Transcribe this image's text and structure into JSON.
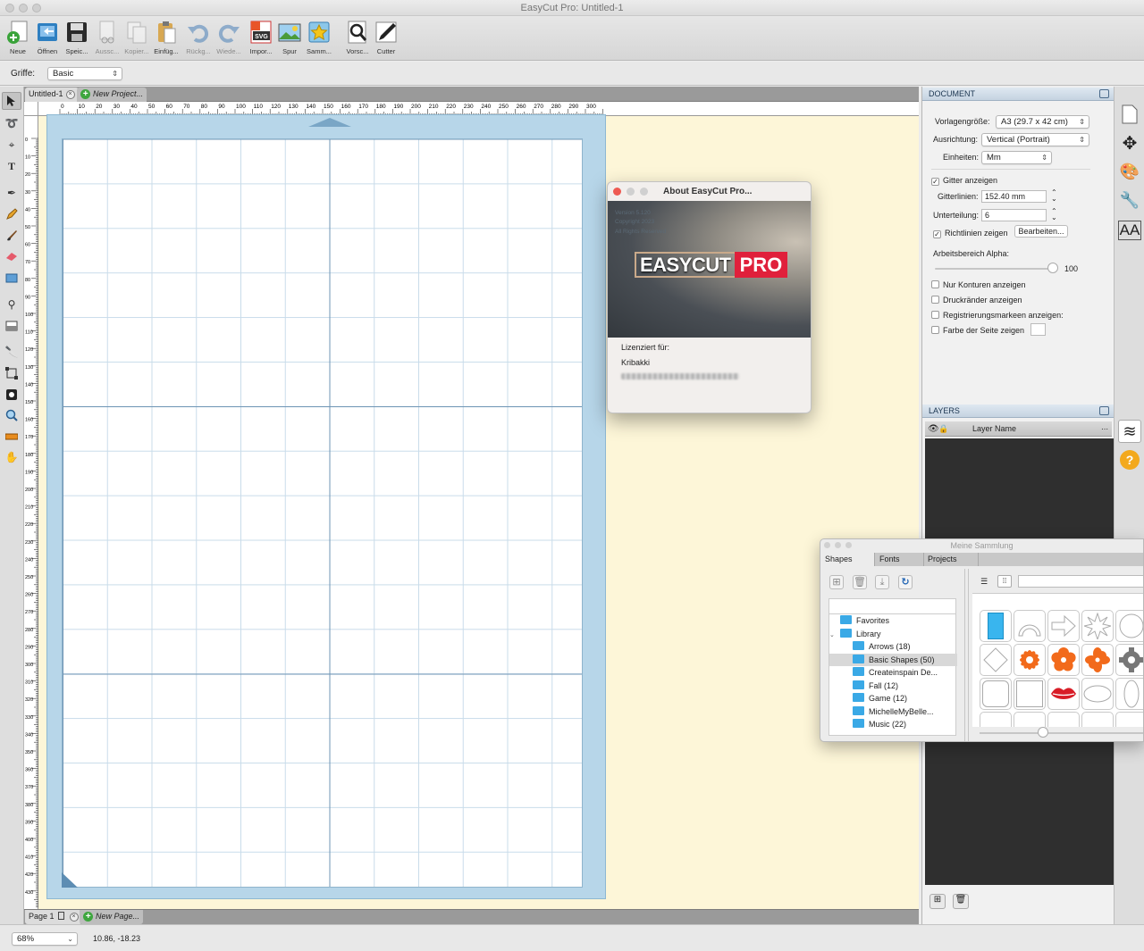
{
  "window": {
    "title": "EasyCut Pro: Untitled-1"
  },
  "toolbar": {
    "items": [
      {
        "label": "Neue",
        "icon": "new-document-icon",
        "enabled": true
      },
      {
        "label": "Öffnen",
        "icon": "open-folder-icon",
        "enabled": true
      },
      {
        "label": "Speic...",
        "icon": "save-icon",
        "enabled": true
      },
      {
        "label": "Aussc...",
        "icon": "cut-icon",
        "enabled": false
      },
      {
        "label": "Kopier...",
        "icon": "copy-icon",
        "enabled": false
      },
      {
        "label": "Einfüg...",
        "icon": "paste-icon",
        "enabled": false
      },
      {
        "label": "Rückg...",
        "icon": "undo-icon",
        "enabled": false
      },
      {
        "label": "Wiede...",
        "icon": "redo-icon",
        "enabled": false
      },
      {
        "label": "Impor...",
        "icon": "import-svg-icon",
        "enabled": true
      },
      {
        "label": "Spur",
        "icon": "trace-icon",
        "enabled": true
      },
      {
        "label": "Samm...",
        "icon": "collection-icon",
        "enabled": true
      },
      {
        "label": "Vorsc...",
        "icon": "preview-icon",
        "enabled": true
      },
      {
        "label": "Cutter",
        "icon": "cutter-icon",
        "enabled": true
      }
    ]
  },
  "options": {
    "griffe_label": "Griffe:",
    "griffe_value": "Basic"
  },
  "tools": [
    "select-arrow-icon",
    "lasso-icon",
    "node-edit-icon",
    "text-tool-icon",
    "pen-tool-icon",
    "pencil-icon",
    "brush-icon",
    "eraser-icon",
    "rectangle-icon",
    "eyedropper-icon",
    "fill-icon",
    "knife-icon",
    "transform-icon",
    "weld-icon",
    "zoom-icon",
    "measure-icon",
    "hand-icon"
  ],
  "doc_tabs": {
    "active": "Untitled-1",
    "new_project": "New Project..."
  },
  "ruler": {
    "top_labels": [
      "0",
      "10",
      "20",
      "30",
      "40",
      "50",
      "60",
      "70",
      "80",
      "90",
      "100",
      "110",
      "120",
      "130",
      "140",
      "150",
      "160",
      "170",
      "180",
      "190",
      "200",
      "210",
      "220",
      "230",
      "240",
      "250",
      "260",
      "270",
      "280",
      "290",
      "300"
    ],
    "left_labels": [
      "0",
      "10",
      "20",
      "30",
      "40",
      "50",
      "60",
      "70",
      "80",
      "90",
      "100",
      "110",
      "120",
      "130",
      "140",
      "150",
      "160",
      "170",
      "180",
      "190",
      "200",
      "210",
      "220",
      "230",
      "240",
      "250",
      "260",
      "270",
      "280",
      "290",
      "300",
      "310",
      "320",
      "330",
      "340",
      "350",
      "360",
      "370",
      "380",
      "390",
      "400",
      "410",
      "420",
      "430"
    ]
  },
  "page_bar": {
    "page": "Page 1",
    "new_page": "New Page..."
  },
  "status": {
    "zoom": "68%",
    "coords": "10.86, -18.23"
  },
  "document_panel": {
    "title": "DOCUMENT",
    "vorlage_label": "Vorlagengröße:",
    "vorlage_value": "A3 (29.7 x 42 cm)",
    "ausrichtung_label": "Ausrichtung:",
    "ausrichtung_value": "Vertical (Portrait)",
    "einheiten_label": "Einheiten:",
    "einheiten_value": "Mm",
    "gitter_label": "Gitter anzeigen",
    "gitter_checked": true,
    "gitterlinien_label": "Gitterlinien:",
    "gitterlinien_value": "152.40 mm",
    "unterteilung_label": "Unterteilung:",
    "unterteilung_value": "6",
    "richtlinien_label": "Richtlinien zeigen",
    "richtlinien_checked": true,
    "bearbeiten_label": "Bearbeiten...",
    "alpha_label": "Arbeitsbereich Alpha:",
    "alpha_value": "100",
    "konturen_label": "Nur Konturen anzeigen",
    "druckraender_label": "Druckränder anzeigen",
    "registrierung_label": "Registrierungsmarkeen anzeigen:",
    "farbe_label": "Farbe der Seite zeigen"
  },
  "layers_panel": {
    "title": "LAYERS",
    "column_header": "Layer Name"
  },
  "right_strip": [
    "page-icon",
    "move-icon",
    "palette-icon",
    "wrench-icon",
    "text-size-icon",
    "layers-icon",
    "help-icon"
  ],
  "about_dialog": {
    "title": "About EasyCut Pro...",
    "version": "Version 5.120",
    "copyright": "Copyright 2023",
    "rights": "All Rights Reserved",
    "logo_left": "EASYCUT",
    "logo_right": "PRO",
    "licensed_label": "Lizenziert für:",
    "licensee": "Kribakki",
    "serial_obscured": "blurred-serial-key"
  },
  "collection": {
    "title": "Meine Sammlung",
    "tabs": [
      "Shapes",
      "Fonts",
      "Projects"
    ],
    "active_tab": "Shapes",
    "tree": [
      {
        "label": "Favorites",
        "indent": 1,
        "selected": false
      },
      {
        "label": "Library",
        "indent": 1,
        "expanded": true,
        "selected": false
      },
      {
        "label": "Arrows (18)",
        "indent": 2,
        "selected": false
      },
      {
        "label": "Basic Shapes (50)",
        "indent": 2,
        "selected": true
      },
      {
        "label": "Createinspain De...",
        "indent": 2,
        "selected": false
      },
      {
        "label": "Fall (12)",
        "indent": 2,
        "selected": false
      },
      {
        "label": "Game (12)",
        "indent": 2,
        "selected": false
      },
      {
        "label": "MichelleMyBelle...",
        "indent": 2,
        "selected": false
      },
      {
        "label": "Music (22)",
        "indent": 2,
        "selected": false
      }
    ],
    "shapes": [
      "blue-rectangle",
      "arc",
      "arrow",
      "cross-burst",
      "circle",
      "diamond",
      "flower-1",
      "flower-2",
      "flower-3",
      "gear",
      "rounded-square",
      "square",
      "lips",
      "oval",
      "ellipse-vertical"
    ],
    "colors": {
      "flower": "#f26a1b",
      "lips": "#d81d27",
      "rectangle": "#39b5ee"
    }
  }
}
